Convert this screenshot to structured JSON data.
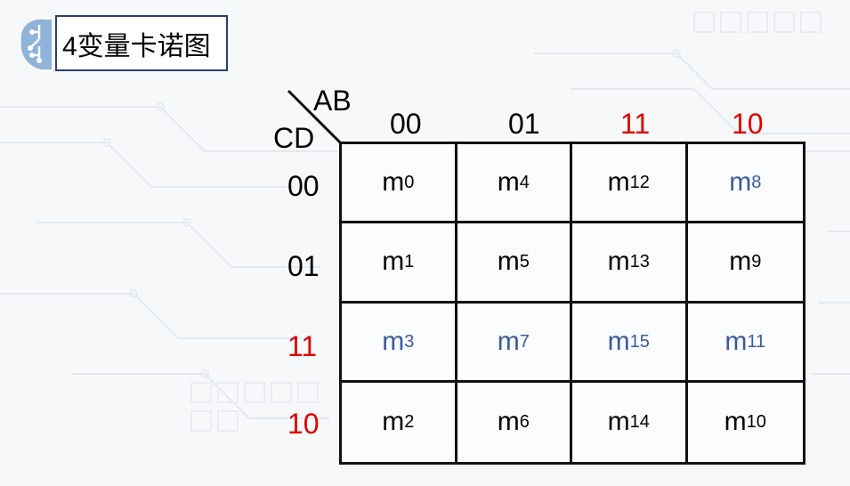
{
  "title": "4变量卡诺图",
  "corner": {
    "row_var": "CD",
    "col_var": "AB"
  },
  "col_labels": [
    {
      "text": "00",
      "color": "black"
    },
    {
      "text": "01",
      "color": "black"
    },
    {
      "text": "11",
      "color": "red"
    },
    {
      "text": "10",
      "color": "red"
    }
  ],
  "row_labels": [
    {
      "text": "00",
      "color": "black"
    },
    {
      "text": "01",
      "color": "black"
    },
    {
      "text": "11",
      "color": "red"
    },
    {
      "text": "10",
      "color": "red"
    }
  ],
  "cells": [
    [
      {
        "base": "m",
        "sub": "0",
        "color": "black"
      },
      {
        "base": "m",
        "sub": "4",
        "color": "black"
      },
      {
        "base": "m",
        "sub": "12",
        "color": "black"
      },
      {
        "base": "m",
        "sub": "8",
        "color": "blue"
      }
    ],
    [
      {
        "base": "m",
        "sub": "1",
        "color": "black"
      },
      {
        "base": "m",
        "sub": "5",
        "color": "black"
      },
      {
        "base": "m",
        "sub": "13",
        "color": "black"
      },
      {
        "base": "m",
        "sub": "9",
        "color": "black"
      }
    ],
    [
      {
        "base": "m",
        "sub": "3",
        "color": "blue"
      },
      {
        "base": "m",
        "sub": "7",
        "color": "blue"
      },
      {
        "base": "m",
        "sub": "15",
        "color": "blue"
      },
      {
        "base": "m",
        "sub": "11",
        "color": "blue"
      }
    ],
    [
      {
        "base": "m",
        "sub": "2",
        "color": "black"
      },
      {
        "base": "m",
        "sub": "6",
        "color": "black"
      },
      {
        "base": "m",
        "sub": "14",
        "color": "black"
      },
      {
        "base": "m",
        "sub": "10",
        "color": "black"
      }
    ]
  ],
  "colors": {
    "red": "#e00000",
    "blue": "#3a5a9c",
    "grid": "#111111",
    "title_border": "#2c3e70"
  }
}
